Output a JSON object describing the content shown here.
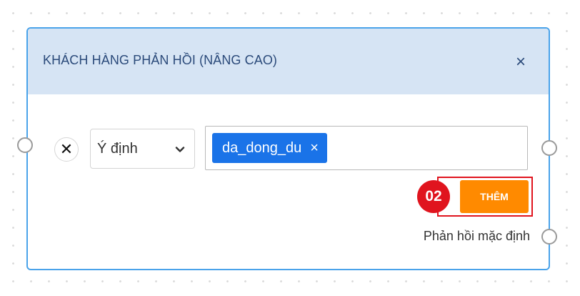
{
  "node": {
    "title": "KHÁCH HÀNG PHẢN HỒI (NÂNG CAO)",
    "close_symbol": "×",
    "close_icon": "close-icon",
    "rule": {
      "remove_symbol": "✕",
      "select": {
        "value": "Ý định",
        "icon": "chevron-down-icon"
      },
      "tags": [
        {
          "label": "da_dong_du",
          "remove_symbol": "×"
        }
      ]
    },
    "add_button_label": "THÊM",
    "step_badge": "02",
    "default_reply_label": "Phản hồi mặc định"
  },
  "colors": {
    "node_border": "#4aa3ea",
    "header_bg": "#d6e4f4",
    "title_text": "#2b4a7a",
    "tag_bg": "#1a73e8",
    "add_button": "#ff8a00",
    "highlight": "#e0141e"
  }
}
